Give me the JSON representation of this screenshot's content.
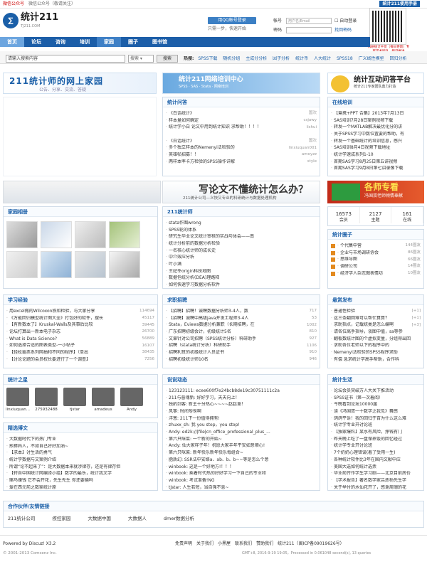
{
  "topbar": {
    "left1": "微信公众号（敬请关注）",
    "red": "微信公众号",
    "right": "统计211使用手册"
  },
  "logo": {
    "title": "统计211",
    "sub": "TJ211.COM"
  },
  "header": {
    "qq_button": "用QQ帐号登录",
    "qq_sub": "只需一步，快速开始",
    "account_label": "帐号",
    "account_placeholder": "用户名/Email",
    "password_label": "密码",
    "remember": "自动登录",
    "find_password": "找回密码",
    "login_button": "登录",
    "register": "立即注册",
    "qr_caption": "科研统计干货（每日更新）专家学术团队，每日推送"
  },
  "nav": [
    "首页",
    "论坛",
    "咨询",
    "培训",
    "家园",
    "圈子",
    "图书馆"
  ],
  "search": {
    "placeholder": "请输入搜索内容",
    "select": "搜索",
    "button": "搜索",
    "hot_label": "热搜:",
    "hot": [
      "SPSS下载",
      "随机分组",
      "主成分分析",
      "因子分析",
      "统计币",
      "人大统计",
      "SPSS18",
      "广义线性模型",
      "回归分析"
    ]
  },
  "banners": {
    "b1_title": "211统计师的网上家园",
    "b1_sub": "公告、分享、交流、答疑",
    "b2_title": "统计211网络培训中心",
    "b2_sub": "SPSS · SAS · Stata · 网络培训",
    "b3_title": "统计互动问答平台",
    "b3_sub": "统计211专家团队鼎力打造"
  },
  "qa": {
    "title": "统计问答",
    "items": [
      {
        "t": "《白话统计》",
        "u": "国次"
      },
      {
        "t": "样本量如何确定",
        "u": "csjawy"
      },
      {
        "t": "统计学小白 论文中用到统计知识 求帮助！！！！",
        "u": "lishui"
      },
      {
        "t": "",
        "u": ""
      },
      {
        "t": "《白话统计》",
        "u": "国次"
      },
      {
        "t": "多个独立样本的Nemenyi法检验的",
        "u": "linxiuquan001"
      },
      {
        "t": "英雄帖招募！！",
        "u": "amoyzz"
      },
      {
        "t": "两样本率卡方检验的SPSS操作详解",
        "u": "style"
      }
    ]
  },
  "training": {
    "title": "在线培训",
    "items": [
      "【竟携+PPT 合集】2013年7月13日",
      "SAS培训7月28日案例视频下载",
      "转发一个MATLAB解决最优化分的讲",
      "关于SPSS学习中数位置要的帮助，有",
      "转发一个基础统计的培训信息，感兴",
      "SAS培训8月4日视频下载地址",
      "统计学速成系列1-10",
      "首期SAS学习8月25日第五讲视频",
      "首期SAS学习9月8日第七讲录像下载"
    ]
  },
  "wide": {
    "title": "写论文不懂统计怎么办？",
    "sub": "211统计公司—义快又专业的科研统计与数据处理机构",
    "ad_title": "各师专看",
    "ad_sub": "冯国双老师倾情奉献"
  },
  "album": {
    "title": "家园相册"
  },
  "teacher": {
    "title": "211统计师",
    "items": [
      "stata作图wrong",
      "SPSS轮的体系",
      "研究生毕业论文统计审核的实战与体会——南",
      "统计分析前的数据分析检验",
      "一名核心统计师的成长史",
      "中介效应分析",
      "叶小满",
      "王妃冬origin科技地图",
      "数据包统分析(DEA)理路释",
      "如何快速学习数据分析软件"
    ]
  },
  "stats": {
    "members": "16573",
    "members_label": "会员",
    "posts": "2127",
    "posts_label": "主题",
    "online": "161",
    "online_label": "在线"
  },
  "circle": {
    "title": "统计圈子",
    "items": [
      {
        "t": "个代集中营",
        "n": "144圈友"
      },
      {
        "t": "企业与市场调研协会",
        "n": "86圈友"
      },
      {
        "t": "思维导图",
        "n": "66圈友"
      },
      {
        "t": "调研公司",
        "n": "14圈友"
      },
      {
        "t": "经济学人杂志图表情坊",
        "n": "10圈友"
      }
    ]
  },
  "learn": {
    "title": "学习经验",
    "items": [
      {
        "t": "用excel做的Wilcoxon秩和检验，与大家分享",
        "n": "114694"
      },
      {
        "t": "《万能回归模型统计图大全》打包好的软件，搜长",
        "n": "45117"
      },
      {
        "t": "【有新数本了】Kruskal-Walls及其事后比较",
        "n": "39445"
      },
      {
        "t": "论坛打算出一新本电子杂志",
        "n": "26700"
      },
      {
        "t": "What is Data Science?",
        "n": "56889"
      },
      {
        "t": "如何选择合适的图表类型-一小帖子",
        "n": "16107"
      },
      {
        "t": "【轻松霸票系列网抽和不同的程序】（单出",
        "n": "38435"
      },
      {
        "t": "【讨论论题的会员权长要进行了一个调查】",
        "n": "7256"
      }
    ]
  },
  "jobs": {
    "title": "求职招聘",
    "items": [
      {
        "t": "【招聘】招聘！诚聘数据分析师3-4人，数",
        "n": "717"
      },
      {
        "t": "【招聘】诚聘中高级java开发工程师3-4人",
        "n": "53"
      },
      {
        "t": "Stata，Eviews数据分析兼职（长期招聘，在",
        "n": "1002"
      },
      {
        "t": "广东招聘初级会计，初级统计5名",
        "n": "810"
      },
      {
        "t": "文章针对公司招聘（SPSS统计分析）科研助手",
        "n": "927"
      },
      {
        "t": "招聘（stata统计分析）科研助手",
        "n": "1106"
      },
      {
        "t": "招聘利贯的初级统计人员证书",
        "n": "910"
      },
      {
        "t": "招聘初级统计师10名",
        "n": "946"
      }
    ]
  },
  "help": {
    "title": "悬赏发布",
    "items": [
      {
        "t": "普通性检验",
        "r": "[+1]"
      },
      {
        "t": "这三条翻回难可以帮忙算算？",
        "r": "[+1]"
      },
      {
        "t": "求助指点，记载统类是怎么编啊",
        "r": "[+3]"
      },
      {
        "t": "请各位高手指导，谈图中值，sa等参",
        "r": ""
      },
      {
        "t": "翻板数统计图的个虚拟变量，分组得出回",
        "r": ""
      },
      {
        "t": "求助各位老师以下的程序中的",
        "r": ""
      },
      {
        "t": "Nemenyi法检验的SPSS程序求助",
        "r": ""
      },
      {
        "t": "有偿 急求统计学高手帮助，合作科",
        "r": ""
      }
    ]
  },
  "stars": {
    "title": "统计之星",
    "items": [
      "linxiuquan...",
      "275932488",
      "tjstar",
      "amadeus",
      "Andy"
    ]
  },
  "say": {
    "title": "说说动态",
    "items": [
      "123123111: ecee600f7e24bcb8de19c30751111c2a",
      "211与普魂新: 好好学习，天天向上！",
      "独酌剑客: 新主十分热心~~~~赵赵谢！",
      "风筝: 时间匆匆啊",
      "洋葱: 211下一份值得拥有!",
      "zhuxx_sh: 我 you stop，you stop!",
      "Andy: ed2k://|file|cn_office_professional_plus_...",
      "第六只咪菜: 一个新的开始~",
      "Andy: 仙大家样子年！祝愿大家羊年平安如意顺心!",
      "第六只咪菜: 新年快乐新年快乐每组合~",
      "脂质幻: SSR法中安络a、ab、b、b~~等是怎么个意",
      "winbook: 这是一个好地方!！！！",
      "winbook: 乘着时代热的好好学习一下自己的专业和",
      "winbook: 考试准备!NG",
      "tjstar: 人生若短，当自强不息~"
    ]
  },
  "life": {
    "title": "统计生活",
    "items": [
      "论坛会员突破万人大关下推活动",
      "SPSS证书（第一次着阅）",
      "今晚看到论坛10000届",
      "读《冯国双一十数学之我见》舞感",
      "鸽鸽平诉！我的回归于百为什么这么难",
      "统计学专业开讨论班",
      "【独家爆料】某水有风险，挣钱有门",
      "昨天晚上吃了一盘保养饭的回忆碰过",
      "统计学专业开讨论班",
      "7个奶奶心理错误(着了受用一生)",
      "各种统计软件比3年在国内文献中应",
      "美国大选如何统计选票",
      "毕业前传作学生学习剧——北京目前房价",
      "【学术报告】著名数学家吕炼杨先生学",
      "关于举付的水仙花开了，感谢周珊的花"
    ]
  },
  "picks": {
    "title": "精选博文",
    "items": [
      "大数据时代下的热门专业",
      "煎棒妈人，不如自己好好加油~",
      "【求本】讨生活的勇气",
      "统计学数据与文案例介绍",
      "所谓“论不起来了”：是大数据本来就涉律存，还是有律存但",
      "【转自中国统计网编译小组】数学的最乐，统计我文学",
      "赌马赚钱 它不会开花，先生先生 你还要输吗",
      "爱在西元前之数家统计原"
    ]
  },
  "partners": {
    "title": "合作伙伴/友情链接",
    "items": [
      "211统计公司",
      "疾控家园",
      "大数据中国",
      "大数据人",
      "dmer数据分析"
    ]
  },
  "footer": {
    "powered": "Powered by Discuz! X3.2",
    "copy": "© 2001-2013 Comsenz Inc.",
    "links": [
      "免责声明",
      "关于我们",
      "小黑屋",
      "联系我们",
      "赞助我们",
      "统计211（闽ICP备09019626号）"
    ],
    "gmt": "GMT+8, 2016-9-19 19:05，Processed in 0.061048 second(s), 13 queries"
  }
}
